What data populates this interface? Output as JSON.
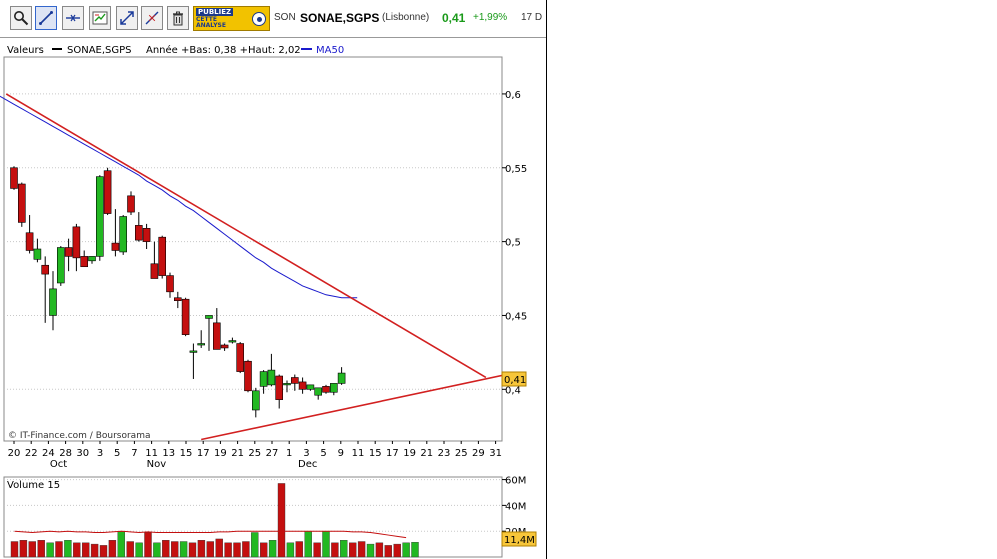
{
  "toolbar": {
    "tools": [
      "zoom-icon",
      "trendline-icon",
      "horizontal-line-icon",
      "indicators-icon",
      "fullscreen-icon",
      "erase-line-icon",
      "trash-icon"
    ],
    "ad": {
      "line1": "PUBLIEZ",
      "line2": "CETTE",
      "line3": "ANALYSE"
    },
    "ticker": "SON",
    "name": "SONAE,SGPS",
    "market": "(Lisbonne)",
    "price": "0,41",
    "change": "+1,99%",
    "date": "17 D"
  },
  "legend": {
    "label": "Valeurs",
    "series": "SONAE,SGPS",
    "info": "Année +Bas: 0,38 +Haut: 2,02",
    "ma": "MA50"
  },
  "credit": "© IT-Finance.com / Boursorama",
  "last_price_tag": "0,41",
  "volume_tag": "11,4M",
  "volume_title": "Volume 15",
  "colors": {
    "up": "#22b822",
    "down": "#c40f0f",
    "ma50": "#1a1acc",
    "trend": "#d22020",
    "tag": "#f7c63a"
  },
  "chart_data": [
    {
      "type": "candlestick",
      "title": "SONAE,SGPS",
      "y_ticks": [
        "0,4",
        "0,45",
        "0,5",
        "0,55",
        "0,6"
      ],
      "y_tick_values": [
        0.4,
        0.45,
        0.5,
        0.55,
        0.6
      ],
      "ylim": [
        0.365,
        0.625
      ],
      "x_tick_labels": [
        "20",
        "22",
        "24",
        "28",
        "30",
        "3",
        "5",
        "7",
        "11",
        "13",
        "15",
        "17",
        "19",
        "21",
        "25",
        "27",
        "1",
        "3",
        "5",
        "9",
        "11",
        "15",
        "17",
        "19",
        "21",
        "23",
        "25",
        "29",
        "31"
      ],
      "x_tick_months": [
        {
          "index": 5,
          "label": "Oct"
        },
        {
          "index": 16,
          "label": "Nov"
        },
        {
          "index": 33,
          "label": "Dec"
        }
      ],
      "candles": [
        {
          "o": 0.55,
          "h": 0.551,
          "l": 0.535,
          "c": 0.536
        },
        {
          "o": 0.539,
          "h": 0.54,
          "l": 0.51,
          "c": 0.513
        },
        {
          "o": 0.506,
          "h": 0.518,
          "l": 0.492,
          "c": 0.494
        },
        {
          "o": 0.488,
          "h": 0.502,
          "l": 0.486,
          "c": 0.495
        },
        {
          "o": 0.484,
          "h": 0.49,
          "l": 0.445,
          "c": 0.478
        },
        {
          "o": 0.45,
          "h": 0.48,
          "l": 0.44,
          "c": 0.468
        },
        {
          "o": 0.472,
          "h": 0.497,
          "l": 0.47,
          "c": 0.496
        },
        {
          "o": 0.496,
          "h": 0.502,
          "l": 0.48,
          "c": 0.49
        },
        {
          "o": 0.51,
          "h": 0.512,
          "l": 0.48,
          "c": 0.489
        },
        {
          "o": 0.49,
          "h": 0.494,
          "l": 0.483,
          "c": 0.483
        },
        {
          "o": 0.487,
          "h": 0.49,
          "l": 0.485,
          "c": 0.49
        },
        {
          "o": 0.49,
          "h": 0.545,
          "l": 0.487,
          "c": 0.544
        },
        {
          "o": 0.548,
          "h": 0.55,
          "l": 0.518,
          "c": 0.519
        },
        {
          "o": 0.499,
          "h": 0.522,
          "l": 0.49,
          "c": 0.494
        },
        {
          "o": 0.493,
          "h": 0.518,
          "l": 0.491,
          "c": 0.517
        },
        {
          "o": 0.531,
          "h": 0.534,
          "l": 0.518,
          "c": 0.52
        },
        {
          "o": 0.511,
          "h": 0.52,
          "l": 0.5,
          "c": 0.501
        },
        {
          "o": 0.509,
          "h": 0.512,
          "l": 0.495,
          "c": 0.5
        },
        {
          "o": 0.485,
          "h": 0.5,
          "l": 0.479,
          "c": 0.475
        },
        {
          "o": 0.503,
          "h": 0.504,
          "l": 0.475,
          "c": 0.477
        },
        {
          "o": 0.477,
          "h": 0.479,
          "l": 0.462,
          "c": 0.466
        },
        {
          "o": 0.462,
          "h": 0.466,
          "l": 0.455,
          "c": 0.46
        },
        {
          "o": 0.461,
          "h": 0.462,
          "l": 0.436,
          "c": 0.437
        },
        {
          "o": 0.426,
          "h": 0.431,
          "l": 0.407,
          "c": 0.426
        },
        {
          "o": 0.43,
          "h": 0.44,
          "l": 0.428,
          "c": 0.431
        },
        {
          "o": 0.448,
          "h": 0.45,
          "l": 0.426,
          "c": 0.45
        },
        {
          "o": 0.445,
          "h": 0.455,
          "l": 0.427,
          "c": 0.427
        },
        {
          "o": 0.43,
          "h": 0.431,
          "l": 0.426,
          "c": 0.428
        },
        {
          "o": 0.433,
          "h": 0.435,
          "l": 0.431,
          "c": 0.433
        },
        {
          "o": 0.431,
          "h": 0.432,
          "l": 0.411,
          "c": 0.412
        },
        {
          "o": 0.419,
          "h": 0.42,
          "l": 0.398,
          "c": 0.399
        },
        {
          "o": 0.386,
          "h": 0.401,
          "l": 0.381,
          "c": 0.399
        },
        {
          "o": 0.402,
          "h": 0.413,
          "l": 0.397,
          "c": 0.412
        },
        {
          "o": 0.403,
          "h": 0.424,
          "l": 0.402,
          "c": 0.413
        },
        {
          "o": 0.409,
          "h": 0.41,
          "l": 0.387,
          "c": 0.393
        },
        {
          "o": 0.404,
          "h": 0.406,
          "l": 0.398,
          "c": 0.404
        },
        {
          "o": 0.408,
          "h": 0.41,
          "l": 0.399,
          "c": 0.404
        },
        {
          "o": 0.405,
          "h": 0.408,
          "l": 0.397,
          "c": 0.4
        },
        {
          "o": 0.4,
          "h": 0.403,
          "l": 0.399,
          "c": 0.403
        },
        {
          "o": 0.396,
          "h": 0.4,
          "l": 0.393,
          "c": 0.401
        },
        {
          "o": 0.402,
          "h": 0.403,
          "l": 0.397,
          "c": 0.398
        },
        {
          "o": 0.398,
          "h": 0.404,
          "l": 0.396,
          "c": 0.404
        },
        {
          "o": 0.404,
          "h": 0.415,
          "l": 0.403,
          "c": 0.411
        }
      ],
      "ma50": [
        0.605,
        0.602,
        0.599,
        0.596,
        0.593,
        0.59,
        0.587,
        0.584,
        0.581,
        0.578,
        0.575,
        0.572,
        0.569,
        0.566,
        0.563,
        0.56,
        0.557,
        0.554,
        0.551,
        0.548,
        0.545,
        0.541,
        0.538,
        0.535,
        0.531,
        0.528,
        0.524,
        0.521,
        0.517,
        0.513,
        0.509,
        0.505,
        0.501,
        0.497,
        0.493,
        0.489,
        0.486,
        0.482,
        0.479,
        0.476,
        0.473,
        0.47,
        0.468,
        0.466,
        0.464,
        0.463,
        0.462,
        0.462,
        0.462
      ],
      "trendlines": [
        {
          "x0": -1,
          "y0": 0.6,
          "x1": 60.5,
          "y1": 0.408
        },
        {
          "x0": 24,
          "y0": 0.366,
          "x1": 64,
          "y1": 0.411
        }
      ],
      "last_value": 0.41
    },
    {
      "type": "bar",
      "title": "Volume 15",
      "y_ticks": [
        "20M",
        "40M",
        "60M"
      ],
      "y_tick_values": [
        20,
        40,
        60
      ],
      "ylim": [
        0,
        62
      ],
      "unit": "M",
      "volumes": [
        12,
        13,
        12,
        13,
        11,
        12,
        13,
        11,
        11,
        10,
        9,
        13,
        20,
        12,
        11,
        19,
        11,
        13,
        12,
        12,
        11,
        13,
        12,
        14,
        11,
        11,
        12,
        19,
        11,
        13,
        57,
        11,
        12,
        20,
        11,
        20,
        11,
        13,
        11,
        12,
        10,
        11,
        9,
        10,
        11,
        11.4
      ],
      "volume_colors": [
        "d",
        "d",
        "d",
        "d",
        "u",
        "d",
        "u",
        "d",
        "d",
        "d",
        "d",
        "d",
        "u",
        "d",
        "u",
        "d",
        "u",
        "d",
        "d",
        "u",
        "d",
        "d",
        "d",
        "d",
        "d",
        "d",
        "d",
        "u",
        "d",
        "u",
        "d",
        "u",
        "d",
        "u",
        "d",
        "u",
        "d",
        "u",
        "d",
        "d",
        "u",
        "d",
        "d",
        "d",
        "u",
        "u"
      ],
      "volume_ma": [
        20,
        19.5,
        19,
        19.5,
        20,
        19.5,
        20,
        19.5,
        19.5,
        19,
        19,
        19.5,
        20,
        19.5,
        19,
        19.5,
        19,
        19,
        19,
        19,
        19,
        19,
        19,
        19.5,
        19.5,
        20,
        20,
        20,
        20,
        20,
        20,
        20,
        20,
        20,
        20,
        20,
        20,
        20,
        19.5,
        19.5,
        19,
        18,
        17,
        16,
        15
      ],
      "last_value": "11,4M"
    }
  ]
}
